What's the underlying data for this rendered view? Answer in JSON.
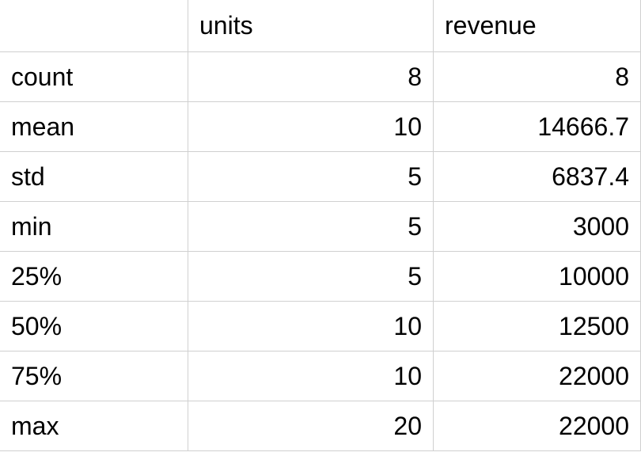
{
  "chart_data": {
    "type": "table",
    "title": "",
    "columns": [
      "units",
      "revenue"
    ],
    "index": [
      "count",
      "mean",
      "std",
      "min",
      "25%",
      "50%",
      "75%",
      "max"
    ],
    "rows": [
      {
        "label": "count",
        "units": "8",
        "revenue": "8"
      },
      {
        "label": "mean",
        "units": "10",
        "revenue": "14666.7"
      },
      {
        "label": "std",
        "units": "5",
        "revenue": "6837.4"
      },
      {
        "label": "min",
        "units": "5",
        "revenue": "3000"
      },
      {
        "label": "25%",
        "units": "5",
        "revenue": "10000"
      },
      {
        "label": "50%",
        "units": "10",
        "revenue": "12500"
      },
      {
        "label": "75%",
        "units": "10",
        "revenue": "22000"
      },
      {
        "label": "max",
        "units": "20",
        "revenue": "22000"
      }
    ]
  },
  "headers": {
    "index": "",
    "units": "units",
    "revenue": "revenue"
  }
}
